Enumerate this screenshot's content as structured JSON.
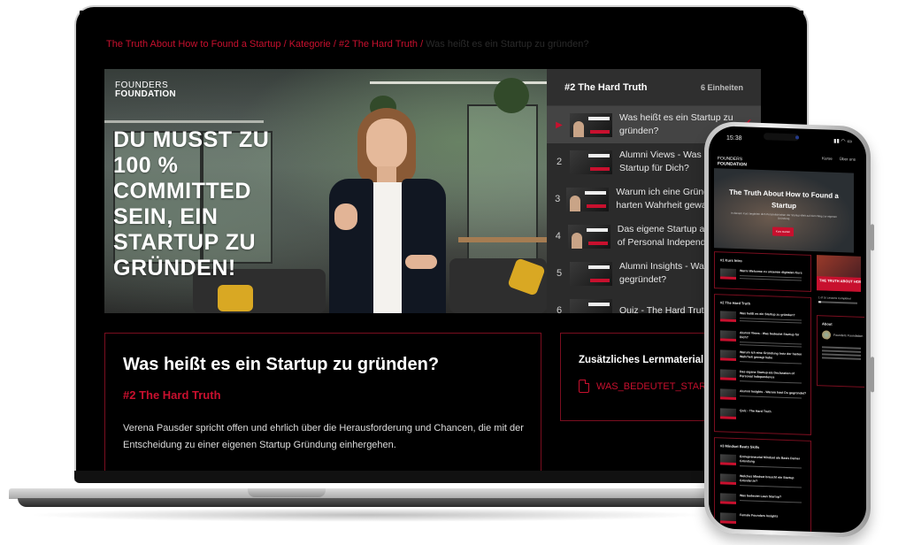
{
  "breadcrumb": {
    "course": "The Truth About How to Found a Startup",
    "separator": " / ",
    "category": "Kategorie",
    "section": "#2 The Hard Truth",
    "current": "Was heißt es ein Startup zu gründen?"
  },
  "video": {
    "brand_line1": "FOUNDERS",
    "brand_line2": "FOUNDATION",
    "quote": "DU MUSST ZU 100 % COMMITTED SEIN, EIN STARTUP ZU GRÜNDEN!"
  },
  "playlist": {
    "title": "#2 The Hard Truth",
    "count": "6 Einheiten",
    "items": [
      {
        "num": "1",
        "line1": "Was heißt es ein Startup zu",
        "line2": "gründen?",
        "active": true,
        "completed": true,
        "play_icon": "▶",
        "check_icon": "✔"
      },
      {
        "num": "2",
        "line1": "Alumni Views - Was bedeutet",
        "line2": "Startup für Dich?"
      },
      {
        "num": "3",
        "line1": "Warum ich eine Gründung trotz der",
        "line2": "harten Wahrheit gewagt habe"
      },
      {
        "num": "4",
        "line1": "Das eigene Startup als Declaration",
        "line2": "of Personal Independence"
      },
      {
        "num": "5",
        "line1": "Alumni Insights - Warum hast Du",
        "line2": "gegründet?"
      },
      {
        "num": "6",
        "line1": "Quiz - The Hard Truth",
        "line2": ""
      }
    ]
  },
  "lesson": {
    "title": "Was heißt es ein Startup zu gründen?",
    "category": "#2 The Hard Truth",
    "description": "Verena Pausder spricht offen und ehrlich über die Herausforderung und Chancen, die mit der Entscheidung zu einer eigenen Startup Gründung einhergehen."
  },
  "materials": {
    "title": "Zusätzliches Lernmaterial",
    "file_name": "WAS_BEDEUTET_STARTUP.pdf"
  },
  "phone": {
    "time": "15:38",
    "status_icons": "▮▮ ◠ ▭",
    "nav": [
      "Kurse",
      "Über uns"
    ],
    "brand_line1": "FOUNDERS",
    "brand_line2": "FOUNDATION",
    "hero_title": "The Truth About How to Found a Startup",
    "hero_subtitle": "In diesem Kurs begleiten dich Persönlichkeiten der Startup-Welt auf dem Weg zur eigenen Gründung.",
    "hero_button": "Kurs starten",
    "sections": [
      {
        "title": "#1 Kurs Intro",
        "rows": [
          "Warm Welcome zu unserem digitalen Kurs"
        ]
      },
      {
        "title": "#2 The Hard Truth",
        "rows": [
          "Was heißt es ein Startup zu gründen?",
          "Alumni Views - Was bedeutet Startup für Dich?",
          "Warum ich eine Gründung trotz der harten Wahrheit gewagt habe",
          "Das eigene Startup als Declaration of Personal Independence",
          "Alumni Insights - Warum hast Du gegründet?",
          "Quiz - The Hard Truth"
        ]
      },
      {
        "title": "#3 Mindset Beats Skills",
        "rows": [
          "Entrepreneurial Mindset als Basis Deiner Gründung",
          "Welches Mindset braucht ein Startup Gründer:in?",
          "Was bedeutet Lean Startup?",
          "Female Founders Insights"
        ]
      }
    ],
    "side_banner": "THE TRUTH ABOUT HOW TO FOUND A STARTUP",
    "progress_label": "1 of 16 Lessons Completed",
    "progress_fraction": 0.0625,
    "about_title": "About",
    "about_name": "Founders Foundation"
  },
  "colors": {
    "accent": "#c8102e",
    "background": "#000000",
    "playlist_bg": "#2b2b2b",
    "box_border": "#7a0e1f"
  }
}
